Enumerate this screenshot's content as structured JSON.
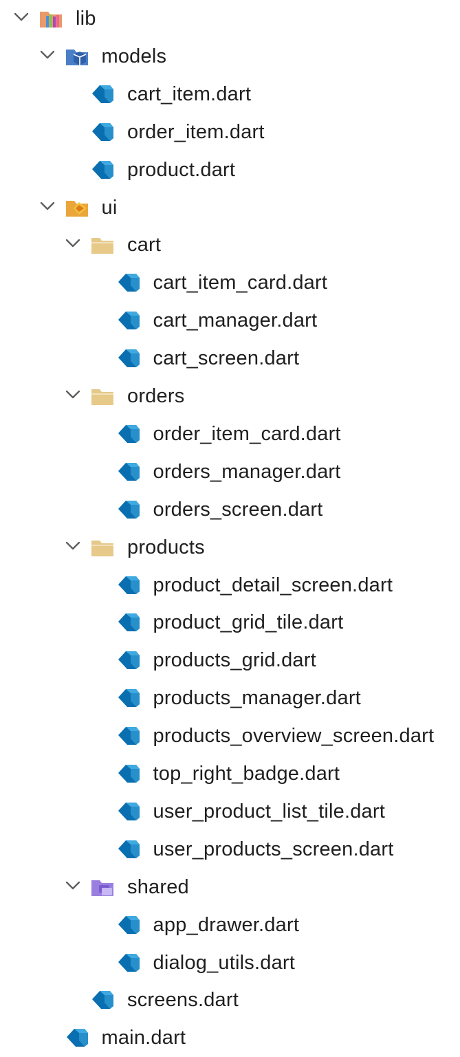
{
  "tree": [
    {
      "label": "lib",
      "kind": "folder-lib",
      "expanded": true,
      "depth": 0
    },
    {
      "label": "models",
      "kind": "folder-models",
      "expanded": true,
      "depth": 1
    },
    {
      "label": "cart_item.dart",
      "kind": "dart-file",
      "depth": 2
    },
    {
      "label": "order_item.dart",
      "kind": "dart-file",
      "depth": 2
    },
    {
      "label": "product.dart",
      "kind": "dart-file",
      "depth": 2
    },
    {
      "label": "ui",
      "kind": "folder-ui",
      "expanded": true,
      "depth": 1
    },
    {
      "label": "cart",
      "kind": "folder",
      "expanded": true,
      "depth": 2
    },
    {
      "label": "cart_item_card.dart",
      "kind": "dart-file",
      "depth": 3
    },
    {
      "label": "cart_manager.dart",
      "kind": "dart-file",
      "depth": 3
    },
    {
      "label": "cart_screen.dart",
      "kind": "dart-file",
      "depth": 3
    },
    {
      "label": "orders",
      "kind": "folder",
      "expanded": true,
      "depth": 2
    },
    {
      "label": "order_item_card.dart",
      "kind": "dart-file",
      "depth": 3
    },
    {
      "label": "orders_manager.dart",
      "kind": "dart-file",
      "depth": 3
    },
    {
      "label": "orders_screen.dart",
      "kind": "dart-file",
      "depth": 3
    },
    {
      "label": "products",
      "kind": "folder",
      "expanded": true,
      "depth": 2
    },
    {
      "label": "product_detail_screen.dart",
      "kind": "dart-file",
      "depth": 3
    },
    {
      "label": "product_grid_tile.dart",
      "kind": "dart-file",
      "depth": 3
    },
    {
      "label": "products_grid.dart",
      "kind": "dart-file",
      "depth": 3
    },
    {
      "label": "products_manager.dart",
      "kind": "dart-file",
      "depth": 3
    },
    {
      "label": "products_overview_screen.dart",
      "kind": "dart-file",
      "depth": 3
    },
    {
      "label": "top_right_badge.dart",
      "kind": "dart-file",
      "depth": 3
    },
    {
      "label": "user_product_list_tile.dart",
      "kind": "dart-file",
      "depth": 3
    },
    {
      "label": "user_products_screen.dart",
      "kind": "dart-file",
      "depth": 3
    },
    {
      "label": "shared",
      "kind": "folder-shared",
      "expanded": true,
      "depth": 2
    },
    {
      "label": "app_drawer.dart",
      "kind": "dart-file",
      "depth": 3
    },
    {
      "label": "dialog_utils.dart",
      "kind": "dart-file",
      "depth": 3
    },
    {
      "label": "screens.dart",
      "kind": "dart-file",
      "depth": 2
    },
    {
      "label": "main.dart",
      "kind": "dart-file",
      "depth": 1
    }
  ],
  "colors": {
    "chevron": "#5f5f5f",
    "dart_dark": "#0a6fb0",
    "dart_light": "#3fa9e0",
    "folder_plain": "#e6c989",
    "folder_lib": "#e89a6a",
    "folder_models": "#4a7fc7",
    "folder_ui": "#eaa63a",
    "folder_shared": "#9b7fe0"
  }
}
